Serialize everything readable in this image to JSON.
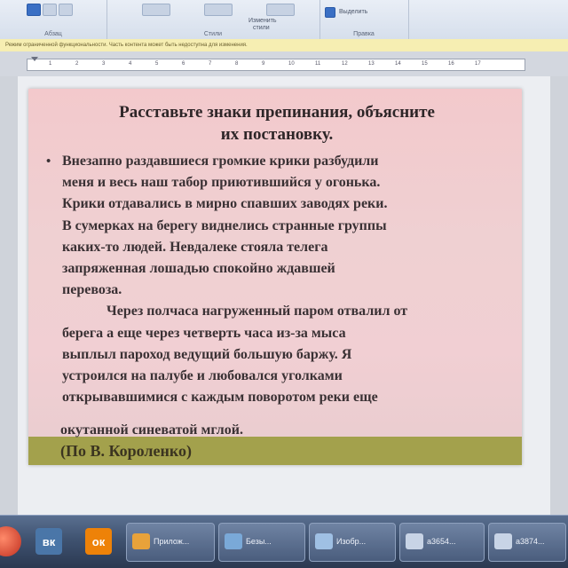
{
  "ribbon": {
    "groups": [
      {
        "caption": "Абзац"
      },
      {
        "caption": "Стили"
      },
      {
        "caption": "Правка"
      }
    ],
    "labels": [
      "Изменить",
      "стили",
      "Выделить"
    ]
  },
  "message_bar": {
    "text": "Режим ограниченной функциональности. Часть контента может быть недоступна для изменения."
  },
  "ruler": {
    "ticks": [
      "1",
      "2",
      "3",
      "4",
      "5",
      "6",
      "7",
      "8",
      "9",
      "10",
      "11",
      "12",
      "13",
      "14",
      "15",
      "16",
      "17"
    ]
  },
  "slide": {
    "title_line1": "Расставьте знаки препинания, объясните",
    "title_line2": "их постановку.",
    "bullet": "•",
    "para1": [
      "Внезапно раздавшиеся громкие крики разбудили",
      "меня и весь наш табор приютившийся у огонька.",
      "Крики отдавались в мирно спавших заводях реки.",
      "В сумерках на берегу виднелись странные группы",
      "каких-то людей. Невдалеке стояла телега",
      "запряженная лошадью спокойно ждавшей",
      "перевоза."
    ],
    "para2": [
      "Через полчаса нагруженный паром отвалил от",
      "берега а еще через четверть часа из-за мыса",
      "выплыл пароход ведущий большую баржу. Я",
      "устроился на палубе и любовался уголками",
      "открывавшимися с каждым поворотом реки еще"
    ],
    "last_line": "окутанной синеватой мглой.",
    "author": "(По В. Короленко)"
  },
  "taskbar": {
    "vk_label": "вк",
    "ok_label": "ок",
    "buttons": [
      {
        "label": "Прилож..."
      },
      {
        "label": "Безы..."
      },
      {
        "label": "Изобр..."
      },
      {
        "label": "a3654..."
      },
      {
        "label": "a3874..."
      }
    ]
  },
  "colors": {
    "slide_bg": "#f3c9cc",
    "strip": "#a3a14c",
    "taskbar": "#3f5270"
  }
}
